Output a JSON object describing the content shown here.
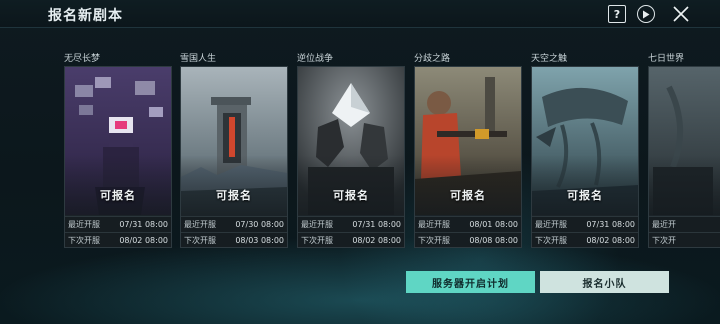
{
  "header": {
    "title": "报名新剧本",
    "help_label": "?"
  },
  "cards": [
    {
      "name": "无尽长梦",
      "status": "可报名",
      "recent_label": "最近开服",
      "recent_time": "07/31 08:00",
      "next_label": "下次开服",
      "next_time": "08/02 08:00"
    },
    {
      "name": "雪国人生",
      "status": "可报名",
      "recent_label": "最近开服",
      "recent_time": "07/30 08:00",
      "next_label": "下次开服",
      "next_time": "08/03 08:00"
    },
    {
      "name": "逆位战争",
      "status": "可报名",
      "recent_label": "最近开服",
      "recent_time": "07/31 08:00",
      "next_label": "下次开服",
      "next_time": "08/02 08:00"
    },
    {
      "name": "分歧之路",
      "status": "可报名",
      "recent_label": "最近开服",
      "recent_time": "08/01 08:00",
      "next_label": "下次开服",
      "next_time": "08/08 08:00"
    },
    {
      "name": "天空之触",
      "status": "可报名",
      "recent_label": "最近开服",
      "recent_time": "07/31 08:00",
      "next_label": "下次开服",
      "next_time": "08/02 08:00"
    },
    {
      "name": "七日世界",
      "status": "",
      "recent_label": "最近开",
      "recent_time": "",
      "next_label": "下次开",
      "next_time": ""
    }
  ],
  "buttons": {
    "server_plan": "服务器开启计划",
    "signup_team": "报名小队"
  },
  "colors": {
    "accent": "#5fd6c4",
    "secondary_button": "#cfe3df",
    "background": "#0b1318"
  }
}
